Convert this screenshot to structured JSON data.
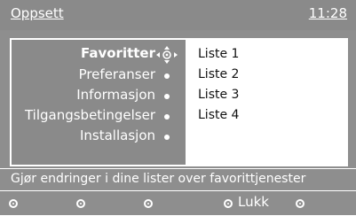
{
  "header": {
    "title": "Oppsett",
    "time": "11:28"
  },
  "menu": {
    "items": [
      {
        "label": "Favoritter",
        "active": true
      },
      {
        "label": "Preferanser",
        "active": false
      },
      {
        "label": "Informasjon",
        "active": false
      },
      {
        "label": "Tilgangsbetingelser",
        "active": false
      },
      {
        "label": "Installasjon",
        "active": false
      }
    ]
  },
  "submenu": {
    "items": [
      "Liste 1",
      "Liste 2",
      "Liste 3",
      "Liste 4"
    ]
  },
  "info": {
    "text": "Gjør endringer i dine lister over favorittjenester"
  },
  "footer": {
    "close_label": "Lukk"
  },
  "colors": {
    "background": "#8e8e8e",
    "text": "#ffffff",
    "panel": "#ffffff"
  }
}
